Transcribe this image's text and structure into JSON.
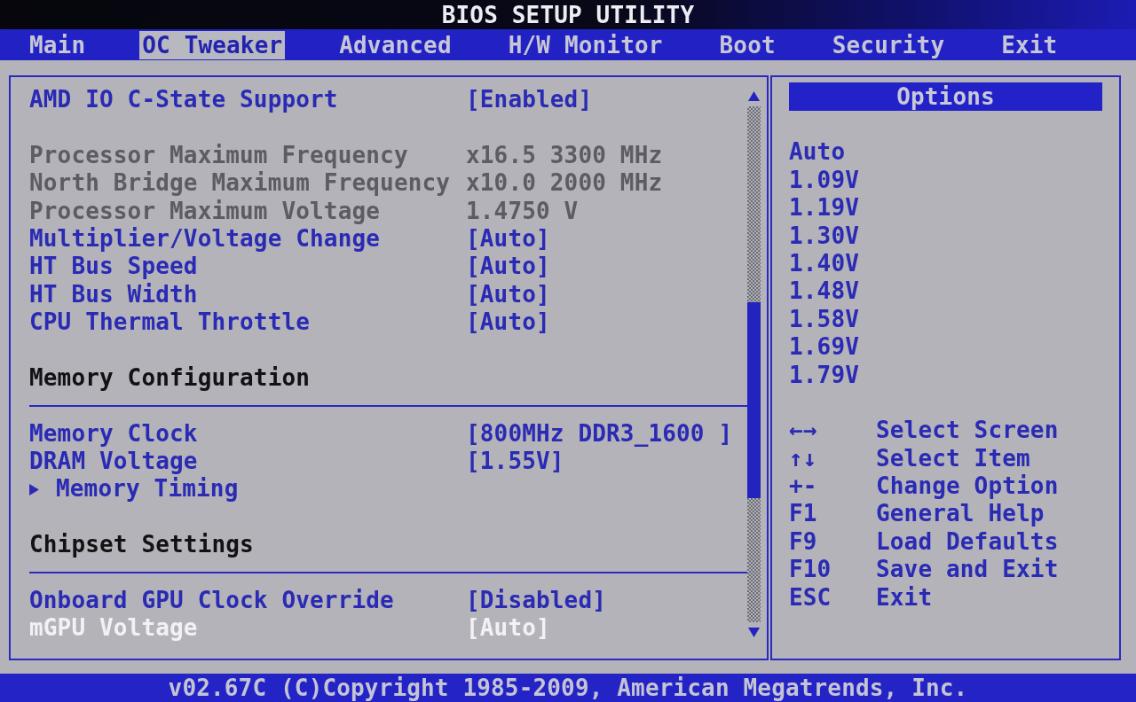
{
  "window": {
    "title": "BIOS SETUP UTILITY"
  },
  "tabs": [
    {
      "label": "Main",
      "selected": false
    },
    {
      "label": "OC Tweaker",
      "selected": true
    },
    {
      "label": "Advanced",
      "selected": false
    },
    {
      "label": "H/W Monitor",
      "selected": false
    },
    {
      "label": "Boot",
      "selected": false
    },
    {
      "label": "Security",
      "selected": false
    },
    {
      "label": "Exit",
      "selected": false
    }
  ],
  "settings": {
    "groups": [
      {
        "items": [
          {
            "kind": "setting",
            "label": "AMD IO C-State Support",
            "value": "[Enabled]",
            "selected": false
          }
        ]
      },
      {
        "items": [
          {
            "kind": "info",
            "label": "Processor Maximum Frequency",
            "value": "x16.5 3300 MHz",
            "selected": false
          },
          {
            "kind": "info",
            "label": "North Bridge Maximum Frequency",
            "value": "x10.0 2000 MHz",
            "selected": false
          },
          {
            "kind": "info",
            "label": "Processor Maximum Voltage",
            "value": "1.4750 V",
            "selected": false
          },
          {
            "kind": "setting",
            "label": "Multiplier/Voltage Change",
            "value": "[Auto]",
            "selected": false
          },
          {
            "kind": "setting",
            "label": "HT Bus Speed",
            "value": "[Auto]",
            "selected": false
          },
          {
            "kind": "setting",
            "label": "HT Bus Width",
            "value": "[Auto]",
            "selected": false
          },
          {
            "kind": "setting",
            "label": "CPU Thermal Throttle",
            "value": "[Auto]",
            "selected": false
          }
        ]
      },
      {
        "heading": "Memory Configuration",
        "items": [
          {
            "kind": "setting",
            "label": "Memory Clock",
            "value": "[800MHz DDR3_1600 ]",
            "selected": false
          },
          {
            "kind": "setting",
            "label": "DRAM Voltage",
            "value": "[1.55V]",
            "selected": false
          },
          {
            "kind": "submenu",
            "label": "Memory Timing",
            "selected": false
          }
        ]
      },
      {
        "heading": "Chipset Settings",
        "items": [
          {
            "kind": "setting",
            "label": "Onboard GPU Clock Override",
            "value": "[Disabled]",
            "selected": false
          },
          {
            "kind": "setting",
            "label": "mGPU Voltage",
            "value": "[Auto]",
            "selected": true
          }
        ]
      }
    ]
  },
  "help": {
    "title": "Options",
    "options": [
      "Auto",
      "1.09V",
      "1.19V",
      "1.30V",
      "1.40V",
      "1.48V",
      "1.58V",
      "1.69V",
      "1.79V"
    ],
    "keys": [
      {
        "key": "←→",
        "action": "Select Screen"
      },
      {
        "key": "↑↓",
        "action": "Select Item"
      },
      {
        "key": "+-",
        "action": "Change Option"
      },
      {
        "key": "F1",
        "action": "General Help"
      },
      {
        "key": "F9",
        "action": "Load Defaults"
      },
      {
        "key": "F10",
        "action": "Save and Exit"
      },
      {
        "key": "ESC",
        "action": "Exit"
      }
    ]
  },
  "status_bar": {
    "text": "v02.67C (C)Copyright 1985-2009, American Megatrends, Inc."
  }
}
